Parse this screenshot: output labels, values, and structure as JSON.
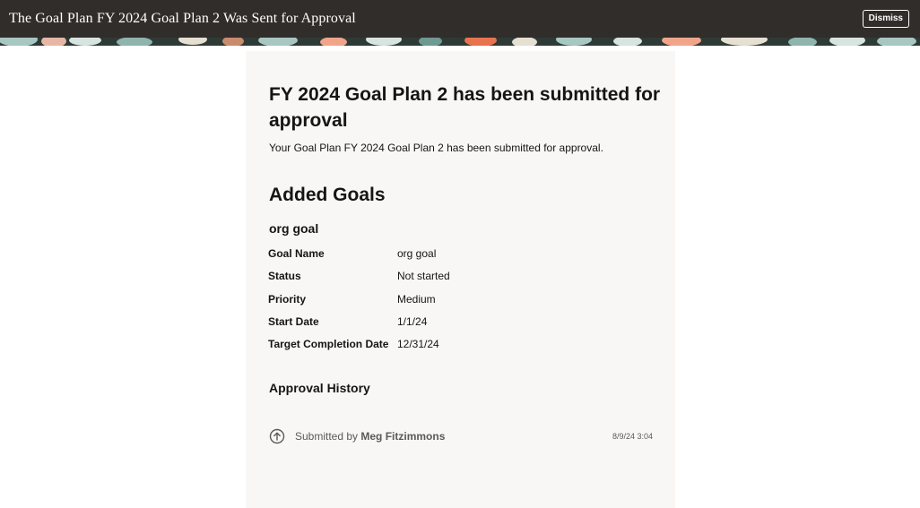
{
  "header": {
    "title": "The Goal Plan FY 2024 Goal Plan 2 Was Sent for Approval",
    "dismiss_label": "Dismiss"
  },
  "card": {
    "title": "FY 2024 Goal Plan 2 has been submitted for approval",
    "subtitle": "Your Goal Plan FY 2024 Goal Plan 2 has been submitted for approval.",
    "added_goals_heading": "Added Goals",
    "goal": {
      "heading": "org goal",
      "fields": [
        {
          "label": "Goal Name",
          "value": "org goal"
        },
        {
          "label": "Status",
          "value": "Not started"
        },
        {
          "label": "Priority",
          "value": "Medium"
        },
        {
          "label": "Start Date",
          "value": "1/1/24"
        },
        {
          "label": "Target Completion Date",
          "value": "12/31/24"
        }
      ]
    },
    "approval_history": {
      "heading": "Approval History",
      "entries": [
        {
          "icon": "arrow-up-circle-icon",
          "prefix": "Submitted by",
          "user": "Meg Fitzimmons",
          "timestamp": "8/9/24 3:04"
        }
      ]
    }
  },
  "colors": {
    "header_bg": "#312d2a",
    "card_bg": "#f9f7f5",
    "text": "#161513",
    "muted_text": "#5c5955"
  }
}
